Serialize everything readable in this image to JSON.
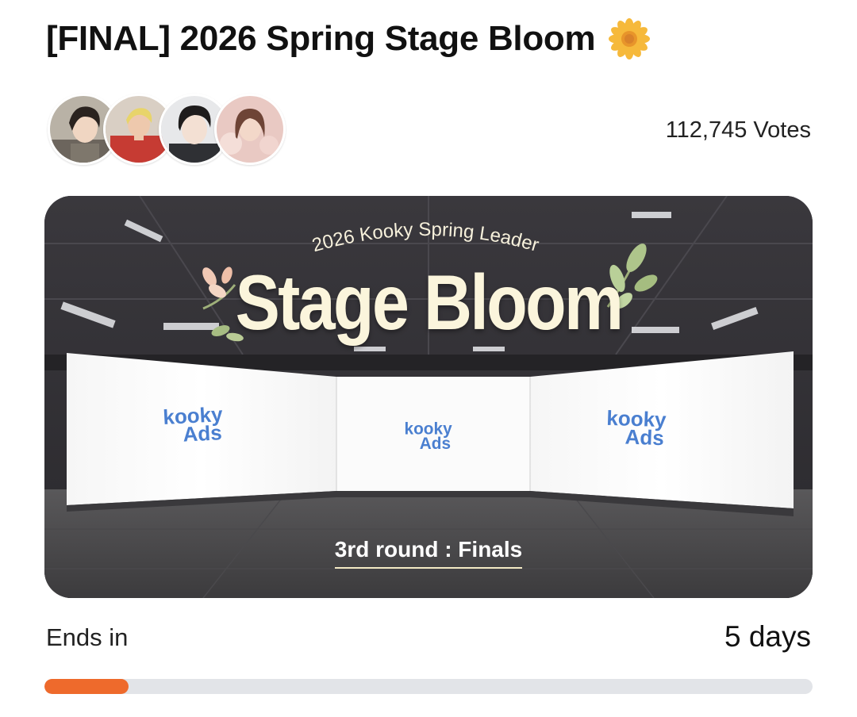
{
  "header": {
    "title": "[FINAL] 2026 Spring Stage Bloom",
    "title_icon": "sunflower-emoji"
  },
  "participants": {
    "avatars": [
      "avatar-1",
      "avatar-2",
      "avatar-3",
      "avatar-4"
    ],
    "votes_label": "112,745 Votes"
  },
  "banner": {
    "subtitle": "2026 Kooky Spring Leader",
    "headline": "Stage Bloom",
    "screen_logo_line1": "kooky",
    "screen_logo_line2": "Ads",
    "round_label": "3rd round : Finals"
  },
  "deadline": {
    "label": "Ends in",
    "value": "5 days",
    "progress_fraction": 0.11
  },
  "colors": {
    "accent": "#ee6a2c",
    "track": "#e2e4e8",
    "headline": "#fbf5dc",
    "logo_blue": "#4a7fd0"
  }
}
